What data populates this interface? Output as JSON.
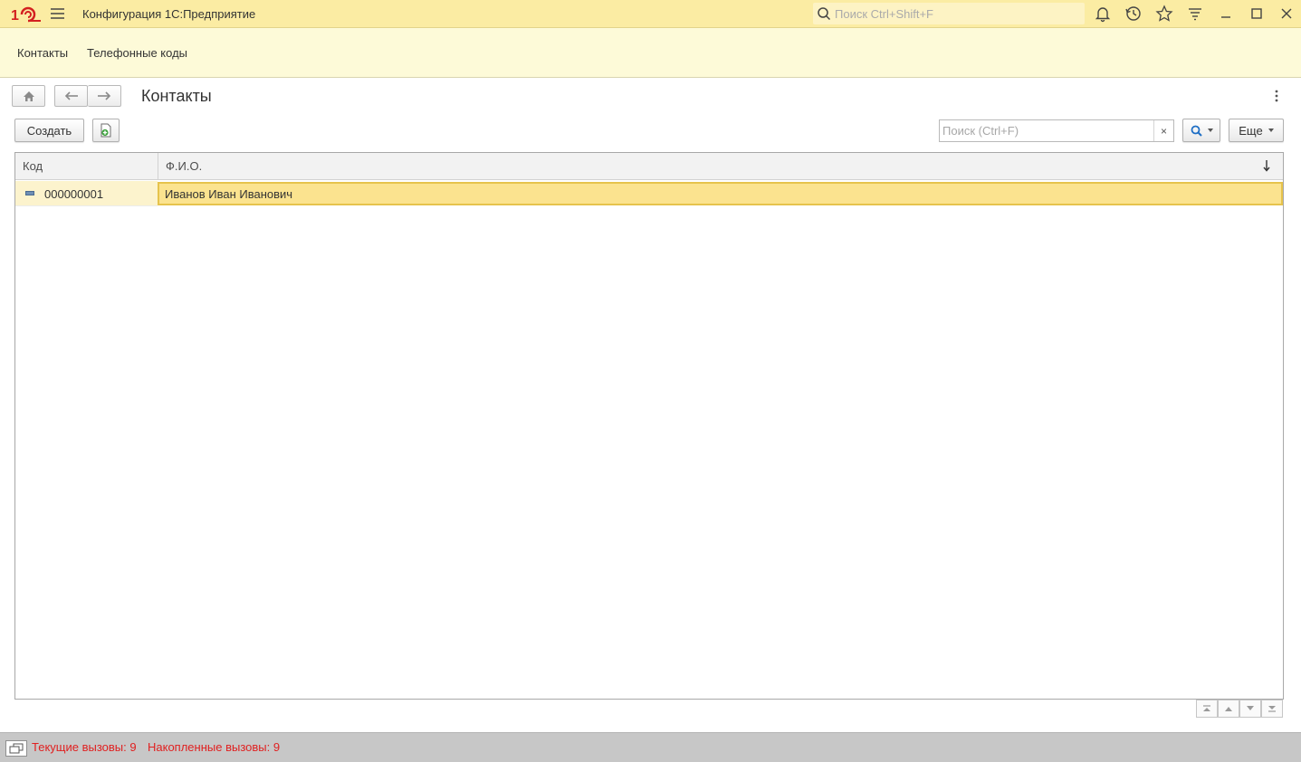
{
  "titlebar": {
    "app_title": "Конфигурация 1С:Предприятие",
    "search_placeholder": "Поиск Ctrl+Shift+F",
    "icons": [
      "1c-logo-icon",
      "menu-icon",
      "search-icon",
      "bell-icon",
      "history-icon",
      "star-icon",
      "funnel-icon",
      "minimize-icon",
      "maximize-icon",
      "close-icon"
    ]
  },
  "sections": {
    "items": [
      {
        "label": "Контакты"
      },
      {
        "label": "Телефонные коды"
      }
    ]
  },
  "form": {
    "title": "Контакты",
    "create_label": "Создать",
    "search_placeholder": "Поиск (Ctrl+F)",
    "clear_label": "×",
    "more_label": "Еще"
  },
  "table": {
    "columns": [
      "Код",
      "Ф.И.О."
    ],
    "rows": [
      {
        "code": "000000001",
        "name": "Иванов Иван Иванович"
      }
    ]
  },
  "status": {
    "current_calls": "Текущие вызовы: 9",
    "accumulated_calls": "Накопленные вызовы: 9"
  },
  "colors": {
    "titlebar_bg": "#fbeca3",
    "sections_bg": "#fdfad8",
    "selected_row": "#fbe38f",
    "status_text": "#e02020"
  }
}
